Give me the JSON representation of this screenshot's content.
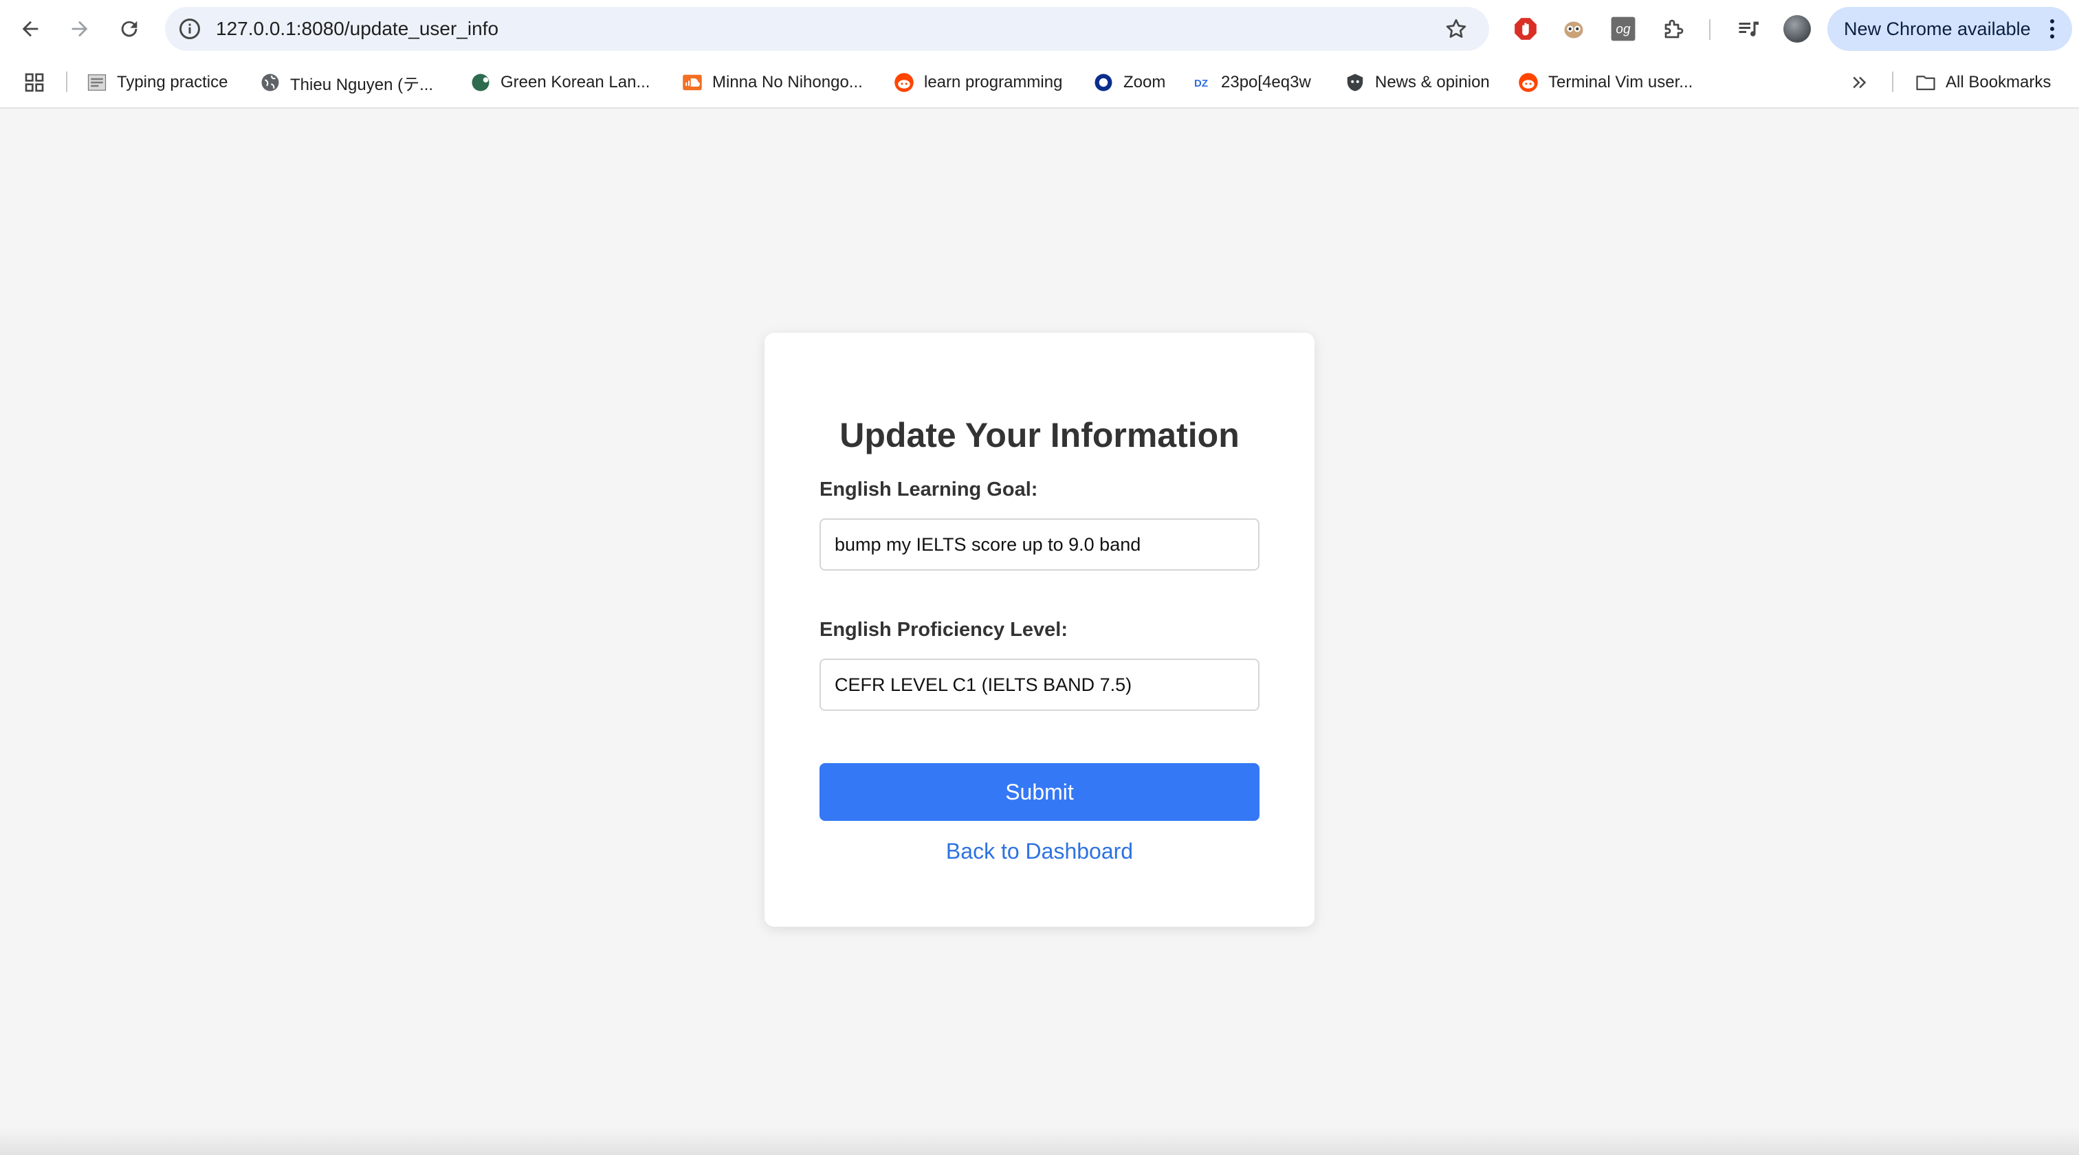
{
  "browser": {
    "url": "127.0.0.1:8080/update_user_info",
    "update_label": "New Chrome available",
    "icons": {
      "back": "arrow-left-icon",
      "forward": "arrow-right-icon",
      "reload": "reload-icon",
      "site_info": "info-icon",
      "bookmark_star": "star-icon",
      "menu": "kebab-icon"
    },
    "extensions": [
      "adblock-extension-icon",
      "owl-extension-icon",
      "og-extension-icon",
      "puzzle-extensions-icon",
      "media-queue-icon"
    ]
  },
  "bookmarks": {
    "items": [
      {
        "label": "Typing practice",
        "icon": "typing-favicon"
      },
      {
        "label": "Thieu Nguyen (テ...",
        "icon": "globe-favicon"
      },
      {
        "label": "Green Korean Lan...",
        "icon": "green-korean-favicon"
      },
      {
        "label": "Minna No Nihongo...",
        "icon": "soundcloud-favicon"
      },
      {
        "label": "learn programming",
        "icon": "reddit-favicon"
      },
      {
        "label": "Zoom",
        "icon": "zoom-favicon"
      },
      {
        "label": "23po[4eq3w",
        "icon": "dz-favicon"
      },
      {
        "label": "News & opinion",
        "icon": "news-favicon"
      },
      {
        "label": "Terminal Vim user...",
        "icon": "reddit-favicon"
      }
    ],
    "overflow_icon": "chevron-double-right-icon",
    "all_bookmarks_label": "All Bookmarks"
  },
  "form": {
    "title": "Update Your Information",
    "goal_label": "English Learning Goal:",
    "goal_value": "bump my IELTS score up to 9.0 band",
    "level_label": "English Proficiency Level:",
    "level_value": "CEFR LEVEL C1 (IELTS BAND 7.5)",
    "submit_label": "Submit",
    "back_label": "Back to Dashboard"
  },
  "colors": {
    "accent": "#3478f6",
    "link": "#2d72e0",
    "page_bg": "#f5f5f5",
    "omnibox_bg": "#edf2fa",
    "update_pill_bg": "#d3e3fd"
  }
}
